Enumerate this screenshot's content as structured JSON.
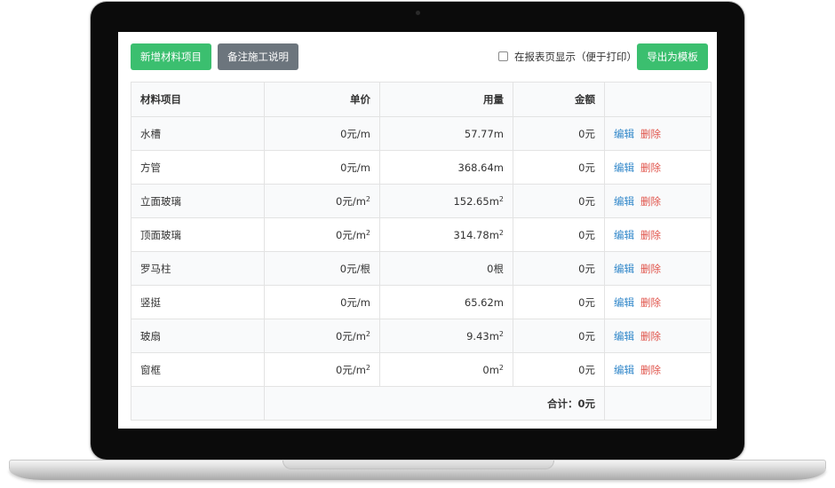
{
  "toolbar": {
    "add_label": "新增材料项目",
    "note_label": "备注施工说明",
    "show_in_report_label": "在报表页显示（便于打印）",
    "export_label": "导出为模板"
  },
  "table": {
    "headers": {
      "name": "材料项目",
      "price": "单价",
      "qty": "用量",
      "amount": "金额",
      "ops": ""
    },
    "rows": [
      {
        "name": "水槽",
        "price": "0元/m",
        "price_sup": "",
        "qty": "57.77m",
        "qty_sup": "",
        "amount": "0元",
        "edit": "编辑",
        "delete": "删除"
      },
      {
        "name": "方管",
        "price": "0元/m",
        "price_sup": "",
        "qty": "368.64m",
        "qty_sup": "",
        "amount": "0元",
        "edit": "编辑",
        "delete": "删除"
      },
      {
        "name": "立面玻璃",
        "price": "0元/m",
        "price_sup": "2",
        "qty": "152.65m",
        "qty_sup": "2",
        "amount": "0元",
        "edit": "编辑",
        "delete": "删除"
      },
      {
        "name": "顶面玻璃",
        "price": "0元/m",
        "price_sup": "2",
        "qty": "314.78m",
        "qty_sup": "2",
        "amount": "0元",
        "edit": "编辑",
        "delete": "删除"
      },
      {
        "name": "罗马柱",
        "price": "0元/根",
        "price_sup": "",
        "qty": "0根",
        "qty_sup": "",
        "amount": "0元",
        "edit": "编辑",
        "delete": "删除"
      },
      {
        "name": "竖挺",
        "price": "0元/m",
        "price_sup": "",
        "qty": "65.62m",
        "qty_sup": "",
        "amount": "0元",
        "edit": "编辑",
        "delete": "删除"
      },
      {
        "name": "玻扇",
        "price": "0元/m",
        "price_sup": "2",
        "qty": "9.43m",
        "qty_sup": "2",
        "amount": "0元",
        "edit": "编辑",
        "delete": "删除"
      },
      {
        "name": "窗框",
        "price": "0元/m",
        "price_sup": "2",
        "qty": "0m",
        "qty_sup": "2",
        "amount": "0元",
        "edit": "编辑",
        "delete": "删除"
      }
    ],
    "total_label": "合计：0元"
  }
}
